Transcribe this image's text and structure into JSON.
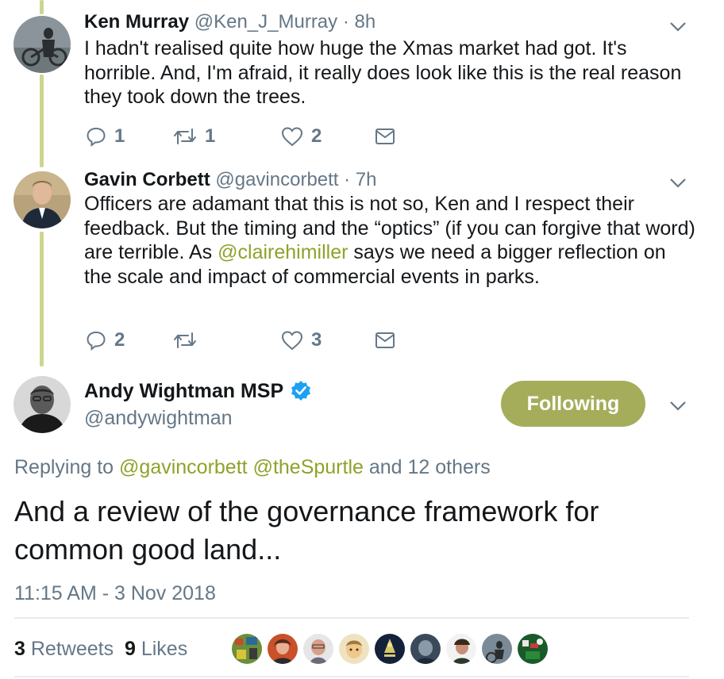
{
  "thread": [
    {
      "name": "Ken Murray",
      "handle": "@Ken_J_Murray",
      "time": "· 8h",
      "text_parts": [
        "I hadn't realised quite how huge the Xmas market had got. It's horrible. And, I'm afraid, it really does look like this is the real reason they took down the trees."
      ],
      "replies": "1",
      "retweets": "1",
      "likes": "2"
    },
    {
      "name": "Gavin Corbett",
      "handle": "@gavincorbett",
      "time": "· 7h",
      "text_before": "Officers are adamant that this is not so, Ken and I respect their feedback. But the timing and the “optics” (if you can forgive that word) are terrible. As ",
      "mention": "@clairehimiller",
      "text_after": " says we need a bigger reflection on the scale and impact of commercial events in parks.",
      "replies": "2",
      "retweets": "",
      "likes": "3"
    }
  ],
  "main_tweet": {
    "name": "Andy Wightman MSP",
    "handle": "@andywightman",
    "follow_label": "Following",
    "replying_prefix": "Replying to",
    "replying_mention_1": "@gavincorbett",
    "replying_mention_2": "@theSpurtle",
    "replying_suffix": "and 12 others",
    "text": "And a review of the governance framework for common good land...",
    "timestamp": "11:15 AM - 3 Nov 2018",
    "retweet_count": "3",
    "retweet_label": "Retweets",
    "like_count": "9",
    "like_label": "Likes"
  },
  "colors": {
    "accent": "#a5ad5a",
    "mention": "#8fa22a",
    "thread_line": "#cdd58f",
    "muted": "#657786",
    "verified": "#1da1f2"
  },
  "icons": [
    "reply-icon",
    "retweet-icon",
    "like-icon",
    "dm-icon",
    "chevron-down-icon",
    "verified-badge-icon"
  ]
}
